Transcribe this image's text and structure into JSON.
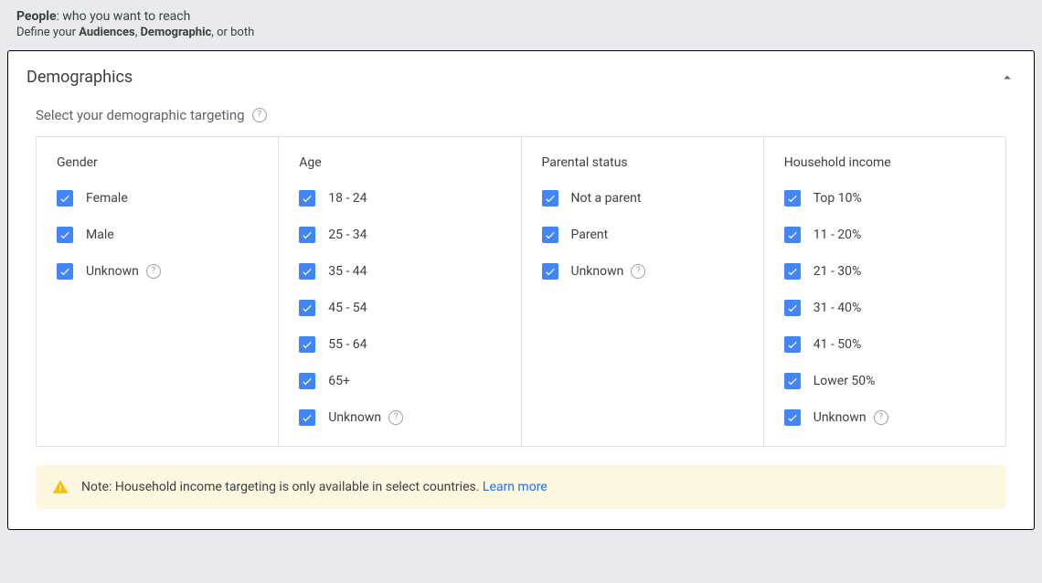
{
  "header": {
    "title_bold": "People",
    "title_rest": ": who you want to reach",
    "subtitle_pre": "Define your ",
    "subtitle_b1": "Audiences",
    "subtitle_mid": ", ",
    "subtitle_b2": "Demographic",
    "subtitle_post": ", or both"
  },
  "panel": {
    "title": "Demographics",
    "subtitle": "Select your demographic targeting"
  },
  "columns": [
    {
      "title": "Gender",
      "options": [
        {
          "label": "Female",
          "help": false
        },
        {
          "label": "Male",
          "help": false
        },
        {
          "label": "Unknown",
          "help": true
        }
      ]
    },
    {
      "title": "Age",
      "options": [
        {
          "label": "18 - 24",
          "help": false
        },
        {
          "label": "25 - 34",
          "help": false
        },
        {
          "label": "35 - 44",
          "help": false
        },
        {
          "label": "45 - 54",
          "help": false
        },
        {
          "label": "55 - 64",
          "help": false
        },
        {
          "label": "65+",
          "help": false
        },
        {
          "label": "Unknown",
          "help": true
        }
      ]
    },
    {
      "title": "Parental status",
      "options": [
        {
          "label": "Not a parent",
          "help": false
        },
        {
          "label": "Parent",
          "help": false
        },
        {
          "label": "Unknown",
          "help": true
        }
      ]
    },
    {
      "title": "Household income",
      "options": [
        {
          "label": "Top 10%",
          "help": false
        },
        {
          "label": "11 - 20%",
          "help": false
        },
        {
          "label": "21 - 30%",
          "help": false
        },
        {
          "label": "31 - 40%",
          "help": false
        },
        {
          "label": "41 - 50%",
          "help": false
        },
        {
          "label": "Lower 50%",
          "help": false
        },
        {
          "label": "Unknown",
          "help": true
        }
      ]
    }
  ],
  "note": {
    "text": "Note: Household income targeting is only available in select countries. ",
    "link": "Learn more"
  }
}
